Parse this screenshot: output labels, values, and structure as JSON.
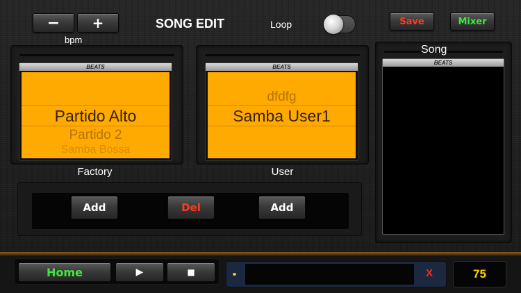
{
  "header": {
    "minus_label": "−",
    "plus_label": "+",
    "bpm_label": "bpm",
    "title": "SONG EDIT",
    "loop_label": "Loop",
    "loop_on": false,
    "save_label": "Save",
    "mixer_label": "Mixer"
  },
  "factory_picker": {
    "tab_label": "BEATS",
    "selected": "Partido Alto",
    "next_1": "Partido 2",
    "next_2": "Samba Bossa",
    "label": "Factory"
  },
  "user_picker": {
    "tab_label": "BEATS",
    "prev_1": "dfdfg",
    "selected": "Samba User1",
    "label": "User"
  },
  "actions": {
    "add_factory_label": "Add",
    "delete_label": "Del",
    "add_user_label": "Add"
  },
  "song": {
    "title": "Song",
    "tab_label": "BEATS",
    "items": []
  },
  "transport": {
    "home_label": "Home",
    "play_icon": "▶",
    "stop_icon": "■"
  },
  "status": {
    "clear_label": "X",
    "tempo": "75"
  },
  "colors": {
    "picker_bg": "#ffaa00",
    "save": "#ff3b1f",
    "mixer": "#3fe83f",
    "home": "#3fe83f",
    "tempo": "#ffd400"
  }
}
